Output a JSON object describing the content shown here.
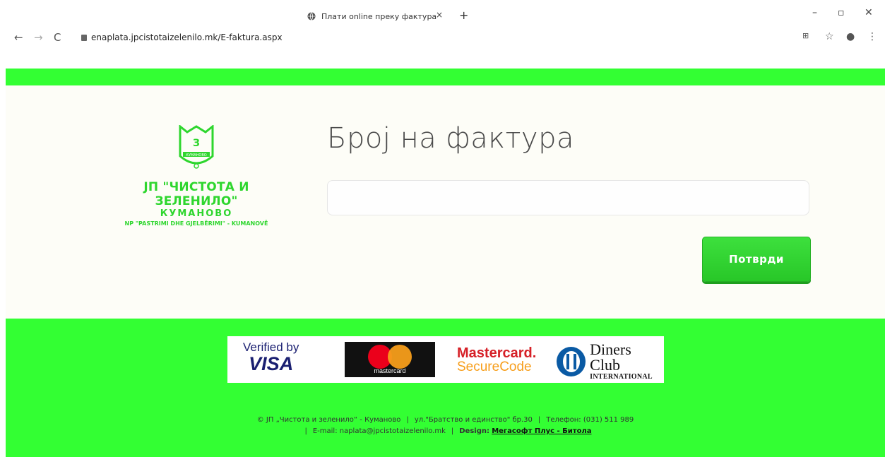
{
  "browser": {
    "tab_title": "Плати online преку фактура",
    "tab_close": "×",
    "new_tab": "+",
    "url": "enaplata.jpcistotaizelenilo.mk/E-faktura.aspx",
    "win_min": "–",
    "win_restore": "▫",
    "win_close": "✕",
    "back": "←",
    "forward": "→",
    "reload": "C",
    "star": "☆",
    "profile": "●",
    "menu": "⋮"
  },
  "logo": {
    "line1": "ЈП \"ЧИСТОТА И ЗЕЛЕНИЛО\"",
    "line2": "КУМАНОВО",
    "line3": "NP \"PASTRIMI DHE GJELBËRIMI\" - KUMANOVË",
    "emblem_text": "КУМАНОВО"
  },
  "form": {
    "heading": "Број на фактура",
    "input_value": "",
    "input_placeholder": "",
    "submit_label": "Потврди"
  },
  "cards": {
    "visa_line1": "Verified by",
    "visa_line2": "VISA",
    "mastercard": "mastercard",
    "mcsc_line1": "Mastercard.",
    "mcsc_line2": "SecureCode",
    "diners_line1": "Diners Club",
    "diners_line2": "INTERNATIONAL"
  },
  "footer": {
    "copyright": "© ЈП „Чистота и зеленило“ - Куманово",
    "address": "ул.\"Братство и единство\" бр.30",
    "phone": "Телефон: (031) 511 989",
    "email": "E-mail: naplata@jpcistotaizelenilo.mk",
    "design_label": "Design:",
    "design_link": "Мегасофт Плус - Битола"
  },
  "colors": {
    "brand_green": "#33ff33",
    "button_green": "#2ed62e"
  }
}
